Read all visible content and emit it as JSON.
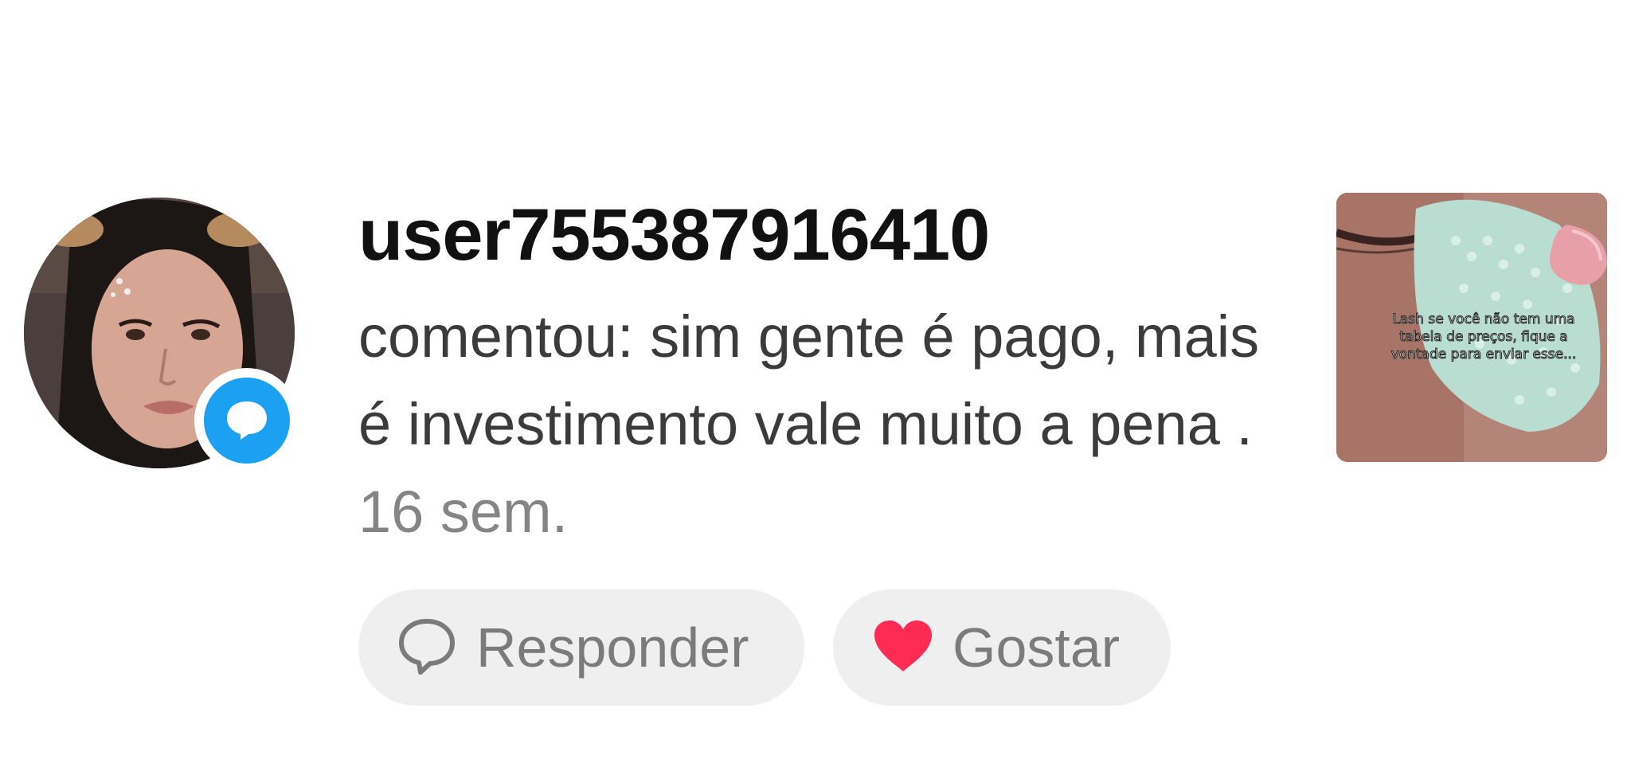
{
  "notification": {
    "username": "user755387916410",
    "comment_text": "comentou: sim gente é pago, mais é investimento vale muito a pena .",
    "timestamp": "16 sem.",
    "avatar_badge_icon": "comment-bubble-icon",
    "badge_color": "#1ba0f2"
  },
  "actions": {
    "reply_label": "Responder",
    "reply_icon": "speech-bubble-outline-icon",
    "like_label": "Gostar",
    "like_icon": "heart-icon",
    "like_color": "#fe2c55"
  },
  "video_thumbnail": {
    "caption": "Lash se você não tem uma tabela de preços, fique a vontade para enviar esse..."
  }
}
